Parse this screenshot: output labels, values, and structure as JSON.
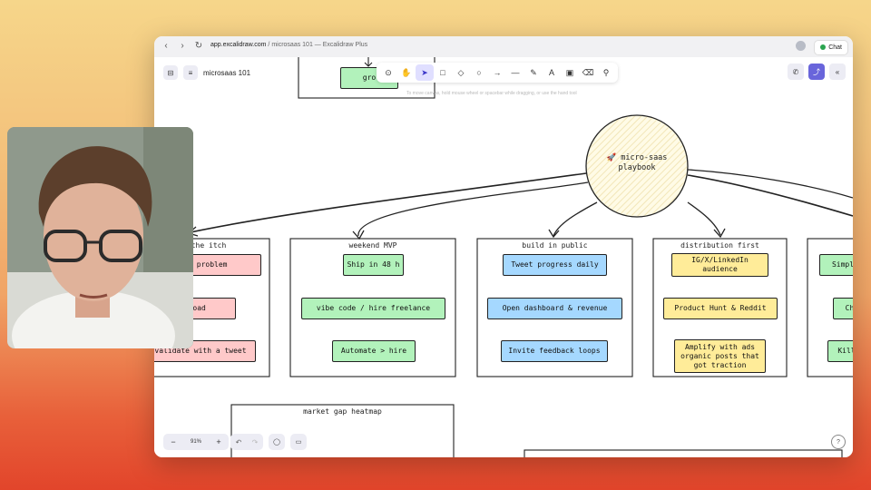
{
  "browser": {
    "url_domain": "app.excalidraw.com",
    "url_rest": " / microsaas 101 — Excalidraw Plus",
    "chat_label": "Chat"
  },
  "app": {
    "doc_name": "microsaas 101",
    "hint": "To move canvas, hold mouse wheel or spacebar while dragging, or use the hand tool",
    "zoom": "91%",
    "tools": [
      "lock-icon",
      "hand-icon",
      "pointer-icon",
      "rectangle-icon",
      "diamond-icon",
      "ellipse-icon",
      "arrow-icon",
      "line-icon",
      "pencil-icon",
      "text-icon",
      "image-icon",
      "eraser-icon",
      "more-tools-icon"
    ]
  },
  "board": {
    "center": "🚀 micro-saas playbook",
    "partial_top_card": "gro",
    "frames": [
      {
        "title": "the itch",
        "cards": [
          "own problem",
          "> broad",
          "validate with a tweet"
        ]
      },
      {
        "title": "weekend MVP",
        "cards": [
          "Ship in 48 h",
          "vibe code / hire freelance",
          "Automate > hire"
        ]
      },
      {
        "title": "build in public",
        "cards": [
          "Tweet progress daily",
          "Open dashboard & revenue",
          "Invite feedback loops"
        ]
      },
      {
        "title": "distribution first",
        "cards": [
          "IG/X/LinkedIn audience",
          "Product Hunt & Reddit",
          "Amplify with ads organic posts that got traction"
        ]
      },
      {
        "title": "",
        "cards": [
          "Simpl",
          "Ch",
          "Kill"
        ]
      }
    ],
    "bottom_frame_title": "market gap heatmap",
    "bottom_right_partial": "... "
  },
  "colors": {
    "pink": "#ffc9c9",
    "green": "#b2f2bb",
    "blue": "#a5d8ff",
    "yellow": "#ffec99",
    "accent": "#6965db"
  }
}
